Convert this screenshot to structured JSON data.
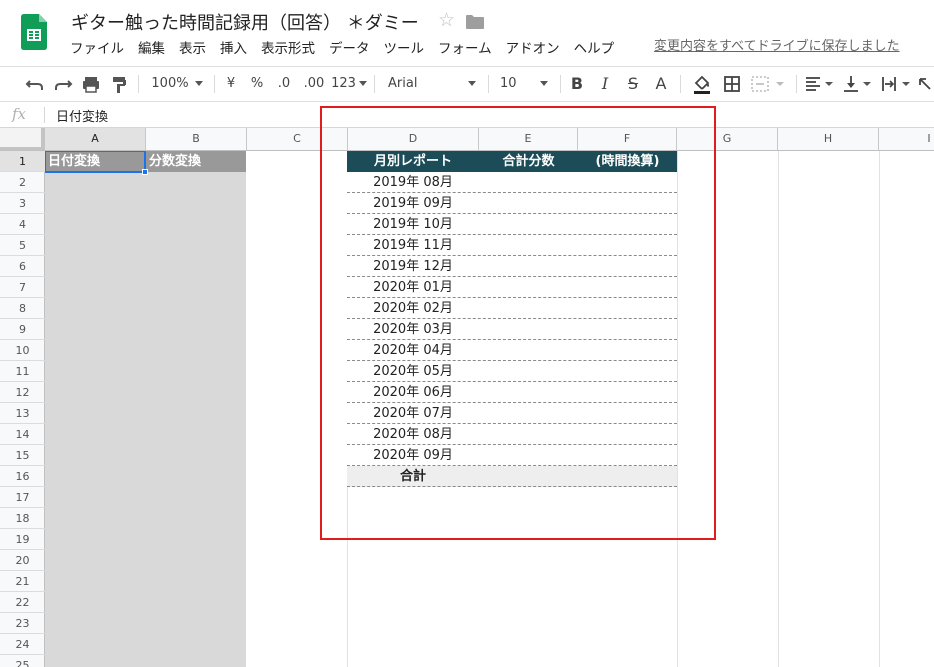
{
  "document": {
    "title": "ギター触った時間記録用（回答） ＊ダミー",
    "last_edit": "変更内容をすべてドライブに保存しました"
  },
  "menu": [
    "ファイル",
    "編集",
    "表示",
    "挿入",
    "表示形式",
    "データ",
    "ツール",
    "フォーム",
    "アドオン",
    "ヘルプ"
  ],
  "toolbar": {
    "zoom": "100%",
    "currency": "¥",
    "percent": "%",
    "decrease_decimal": ".0",
    "increase_decimal": ".00",
    "more_formats": "123",
    "font": "Arial",
    "font_size": "10",
    "bold": "B",
    "italic": "I",
    "strikethrough": "S",
    "text_color": "A"
  },
  "formula_bar": {
    "fx": "fx",
    "content": "日付変換"
  },
  "columns": [
    "A",
    "B",
    "C",
    "D",
    "E",
    "F",
    "G",
    "H",
    "I"
  ],
  "rows": [
    "1",
    "2",
    "3",
    "4",
    "5",
    "6",
    "7",
    "8",
    "9",
    "10",
    "11",
    "12",
    "13",
    "14",
    "15",
    "16",
    "17",
    "18",
    "19",
    "20",
    "21",
    "22",
    "23",
    "24",
    "25"
  ],
  "cells": {
    "A1": "日付変換",
    "B1": "分数変換"
  },
  "report": {
    "headers": [
      "月別レポート",
      "合計分数",
      "(時間換算)"
    ],
    "months": [
      "2019年 08月",
      "2019年 09月",
      "2019年 10月",
      "2019年 11月",
      "2019年 12月",
      "2020年 01月",
      "2020年 02月",
      "2020年 03月",
      "2020年 04月",
      "2020年 05月",
      "2020年 06月",
      "2020年 07月",
      "2020年 08月",
      "2020年 09月"
    ],
    "total_label": "合計"
  },
  "colors": {
    "report_header_bg": "#1c4c57",
    "highlight_box": "#e01c1c",
    "selection": "#1a73e8",
    "sheets_green": "#0f9d58"
  }
}
